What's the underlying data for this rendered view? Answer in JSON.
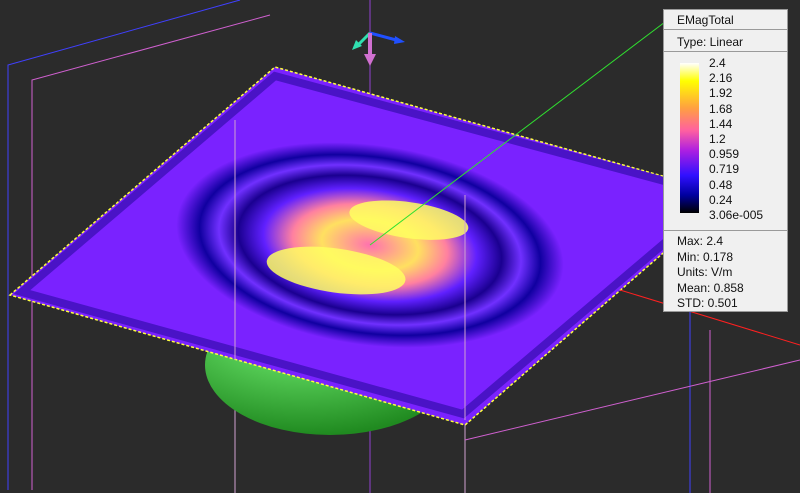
{
  "legend": {
    "title": "EMagTotal",
    "type": "Type: Linear",
    "ticks": [
      "2.4",
      "2.16",
      "1.92",
      "1.68",
      "1.44",
      "1.2",
      "0.959",
      "0.719",
      "0.48",
      "0.24",
      "3.06e-005"
    ],
    "stats": {
      "max": "Max: 2.4",
      "min": "Min: 0.178",
      "units": "Units: V/m",
      "mean": "Mean: 0.858",
      "std": "STD: 0.501"
    }
  },
  "colors": {
    "background": "#2b2b2b",
    "plate": "#7a22ff",
    "outline": "#ffff40",
    "sphere": "#3cc43c"
  }
}
